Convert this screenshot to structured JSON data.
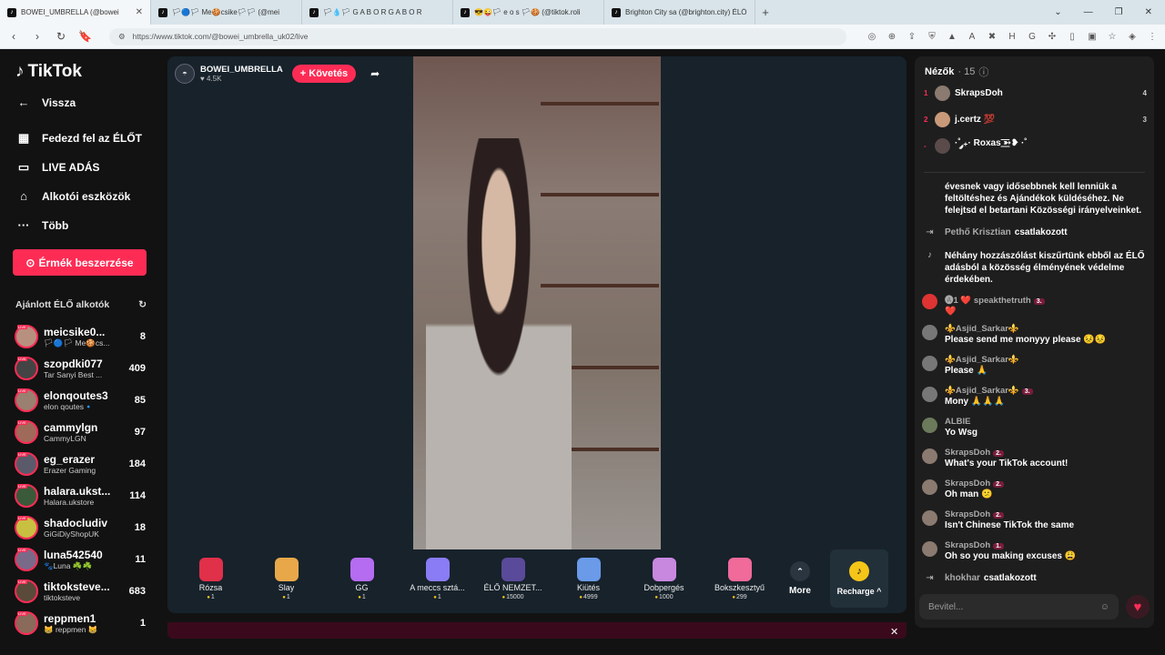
{
  "browser": {
    "tabs": [
      {
        "title": "BOWEI_UMBRELLA (@bowei",
        "active": true
      },
      {
        "title": "🏳🔵🏳 Me🍪csike🏳🏳 (@mei",
        "active": false
      },
      {
        "title": "🏳💧🏳 G A B O R G A B O R",
        "active": false
      },
      {
        "title": "😎😜🏳 e o s 🏳🍪 (@tiktok.roli",
        "active": false
      },
      {
        "title": "Brighton City sa (@brighton.city) ÉLŐ",
        "active": false
      }
    ],
    "new_tab": "+",
    "url": "https://www.tiktok.com/@bowei_umbrella_uk02/live"
  },
  "sidebar": {
    "logo": "TikTok",
    "back": "Vissza",
    "nav": [
      {
        "label": "Fedezd fel az ÉLŐT",
        "icon": "calendar-icon"
      },
      {
        "label": "LIVE ADÁS",
        "icon": "camera-icon"
      },
      {
        "label": "Alkotói eszközök",
        "icon": "house-icon"
      },
      {
        "label": "Több",
        "icon": "more-icon"
      }
    ],
    "coin_button": "Érmék beszerzése",
    "recommended_title": "Ajánlott ÉLŐ alkotók",
    "creators": [
      {
        "name": "meicsike0...",
        "sub": "🏳🔵🏳 Me🍪cs...",
        "count": "8"
      },
      {
        "name": "szopdki077",
        "sub": "Tar Sanyi Best ...",
        "count": "409"
      },
      {
        "name": "elonqoutes3",
        "sub": "elon qoutes🔹",
        "count": "85"
      },
      {
        "name": "cammylgn",
        "sub": "CammyLGN",
        "count": "97"
      },
      {
        "name": "eg_erazer",
        "sub": "Erazer Gaming",
        "count": "184"
      },
      {
        "name": "halara.ukst...",
        "sub": "Halara.ukstore",
        "count": "114"
      },
      {
        "name": "shadocludiv",
        "sub": "GiGiDiyShopUK",
        "count": "18"
      },
      {
        "name": "luna542540",
        "sub": "🐾Luna ☘️☘️",
        "count": "11"
      },
      {
        "name": "tiktoksteve...",
        "sub": "tiktoksteve",
        "count": "683"
      },
      {
        "name": "reppmen1",
        "sub": "😸 reppmen 😸",
        "count": "1"
      }
    ]
  },
  "stream": {
    "host": "BOWEI_UMBRELLA",
    "likes": "4.5K",
    "follow": "+ Követés",
    "gifts": [
      {
        "name": "Rózsa",
        "price": "1",
        "color": "#e0304a"
      },
      {
        "name": "Slay",
        "price": "1",
        "color": "#e8a84a"
      },
      {
        "name": "GG",
        "price": "1",
        "color": "#b56cf0"
      },
      {
        "name": "A meccs sztá...",
        "price": "1",
        "color": "#8a7cf5"
      },
      {
        "name": "ÉLŐ NEMZET...",
        "price": "15000",
        "color": "#5a4a9a"
      },
      {
        "name": "Kiütés",
        "price": "4999",
        "color": "#6a9ae8"
      },
      {
        "name": "Dobpergés",
        "price": "1000",
        "color": "#c888e0"
      },
      {
        "name": "Bokszkesztyű",
        "price": "299",
        "color": "#f06a9a"
      }
    ],
    "more": "More",
    "recharge": "Recharge ^"
  },
  "panel": {
    "viewers_title": "Nézők",
    "viewers_count": "· 15",
    "viewers": [
      {
        "rank": "1",
        "name": "SkrapsDoh",
        "score": "4"
      },
      {
        "rank": "2",
        "name": "j.certz 💯",
        "score": "3"
      },
      {
        "rank": "-",
        "name": "·˚ ༘₊· Roxas ͟͟͞͞➳❥ ·˚",
        "score": ""
      }
    ],
    "messages": [
      {
        "type": "system",
        "text": "évesnek vagy idősebbnek kell lenniük a feltöltéshez és Ajándékok küldéséhez. Ne felejtsd el betartani Közösségi irányelveinket."
      },
      {
        "type": "join",
        "user": "Pethő Krisztian",
        "text": "csatlakozott"
      },
      {
        "type": "system2",
        "text": "Néhány hozzászólást kiszűrtünk ebből az ÉLŐ adásból a közösség élményének védelme érdekében."
      },
      {
        "type": "chat",
        "user": "🅐1 ❤️ speakthetruth",
        "badge": "3.",
        "text": "❤️"
      },
      {
        "type": "chat",
        "user": "⚜️Asjid_Sarkar⚜️",
        "badge": "",
        "text": "Please send me monyyy please 😣😣"
      },
      {
        "type": "chat",
        "user": "⚜️Asjid_Sarkar⚜️",
        "badge": "",
        "text": "Please 🙏"
      },
      {
        "type": "chat",
        "user": "⚜️Asjid_Sarkar⚜️",
        "badge": "3.",
        "text": "Mony 🙏🙏🙏"
      },
      {
        "type": "chat",
        "user": "ALBIE",
        "badge": "",
        "text": "Yo Wsg"
      },
      {
        "type": "chat",
        "user": "SkrapsDoh",
        "badge": "2.",
        "text": "What's your TikTok account!"
      },
      {
        "type": "chat",
        "user": "SkrapsDoh",
        "badge": "2.",
        "text": "Oh man 😕"
      },
      {
        "type": "chat",
        "user": "SkrapsDoh",
        "badge": "2.",
        "text": "Isn't Chinese TikTok the same"
      },
      {
        "type": "chat",
        "user": "SkrapsDoh",
        "badge": "1.",
        "text": "Oh so you making excuses 😩"
      },
      {
        "type": "join",
        "user": "khokhar",
        "text": "csatlakozott"
      }
    ],
    "input_placeholder": "Bevitel..."
  }
}
